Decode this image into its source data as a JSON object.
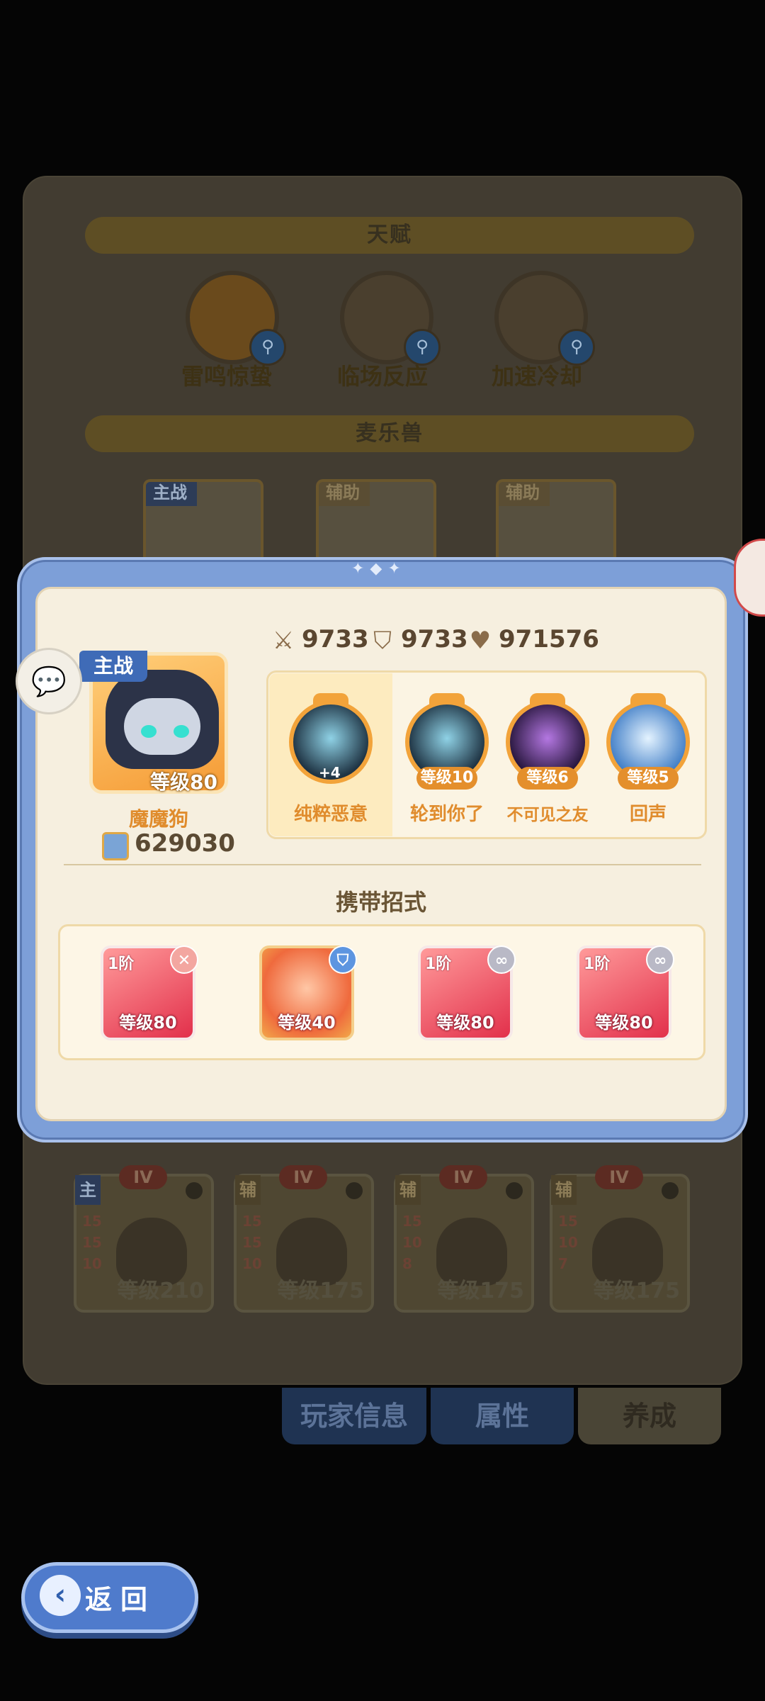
{
  "background_panel": {
    "talent_title": "天赋",
    "talents": [
      {
        "label": "雷鸣惊蛰",
        "icon": "thunder-talent-icon"
      },
      {
        "label": "临场反应",
        "icon": "reaction-talent-icon"
      },
      {
        "label": "加速冷却",
        "icon": "cooldown-talent-icon"
      }
    ],
    "pets_title": "麦乐兽",
    "pet_slots": [
      {
        "tag": "主战"
      },
      {
        "tag": "辅助"
      },
      {
        "tag": "辅助"
      }
    ],
    "team_cards": [
      {
        "role": "主",
        "rank": "IV",
        "stats": [
          "15",
          "15",
          "10"
        ],
        "level": "等级210"
      },
      {
        "role": "辅",
        "rank": "IV",
        "stats": [
          "15",
          "15",
          "10"
        ],
        "level": "等级175"
      },
      {
        "role": "辅",
        "rank": "IV",
        "stats": [
          "15",
          "10",
          "8"
        ],
        "level": "等级175"
      },
      {
        "role": "辅",
        "rank": "IV",
        "stats": [
          "15",
          "10",
          "7"
        ],
        "level": "等级175"
      }
    ],
    "tabs": [
      {
        "label": "玩家信息"
      },
      {
        "label": "属性"
      },
      {
        "label": "养成"
      }
    ]
  },
  "detail": {
    "stats": {
      "attack": "9733",
      "defense": "9733",
      "hp": "971576"
    },
    "pet": {
      "role_tag": "主战",
      "level": "等级80",
      "name": "魔魔狗",
      "power": "629030"
    },
    "skills": [
      {
        "name": "纯粹恶意",
        "badge": "+4"
      },
      {
        "name": "轮到你了",
        "level": "等级10"
      },
      {
        "name": "不可见之友",
        "level": "等级6"
      },
      {
        "name": "回声",
        "level": "等级5"
      }
    ],
    "moves_title": "携带招式",
    "moves": [
      {
        "tier": "1阶",
        "level": "等级80",
        "badge_icon": "attack-swords-icon"
      },
      {
        "tier": "",
        "level": "等级40",
        "badge_icon": "shield-icon"
      },
      {
        "tier": "1阶",
        "level": "等级80",
        "badge_icon": "link-icon"
      },
      {
        "tier": "1阶",
        "level": "等级80",
        "badge_icon": "link-icon"
      }
    ]
  },
  "back_button": {
    "label": "返回"
  },
  "colors": {
    "modal_frame": "#7d9fd8",
    "panel_cream": "#f6efdf",
    "accent_orange": "#e08c2d",
    "role_blue": "#3f6bb7"
  }
}
